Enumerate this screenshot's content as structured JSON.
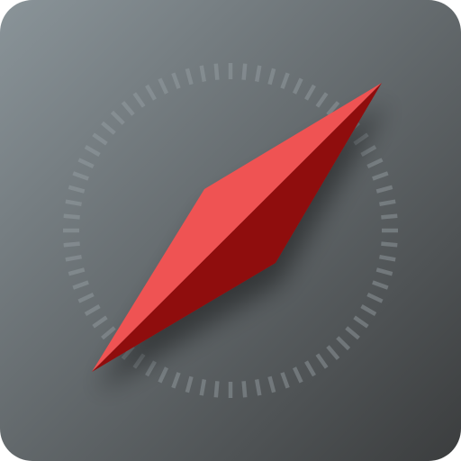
{
  "icon": {
    "name": "compass-app-icon",
    "symbol": "compass-needle-icon"
  },
  "colors": {
    "background_top_left": "#8a9499",
    "background_bottom_right": "#3b3d3e",
    "tick_marks": "#9aa2a6",
    "needle_light": "#ef5252",
    "needle_dark": "#8f0c0c",
    "shadow": "#000000"
  },
  "dial": {
    "tick_count": 72
  }
}
